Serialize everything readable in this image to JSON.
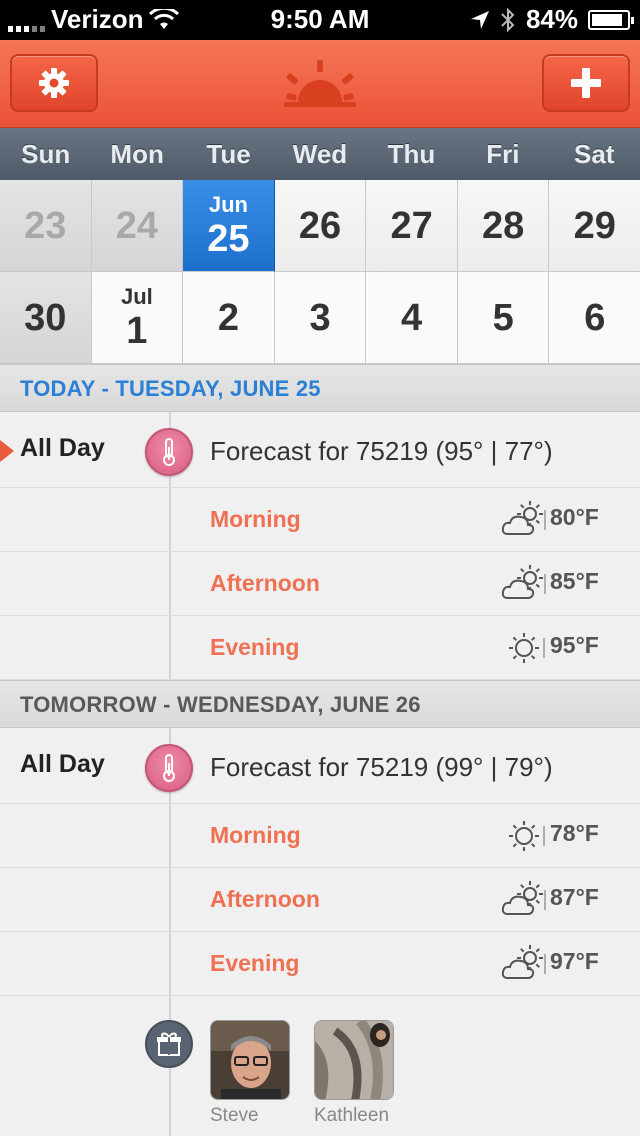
{
  "status": {
    "carrier": "Verizon",
    "time": "9:50 AM",
    "battery": "84%"
  },
  "weekdays": [
    "Sun",
    "Mon",
    "Tue",
    "Wed",
    "Thu",
    "Fri",
    "Sat"
  ],
  "calendar": {
    "row1": [
      {
        "day": "23",
        "month": "",
        "state": "past"
      },
      {
        "day": "24",
        "month": "",
        "state": "past"
      },
      {
        "day": "25",
        "month": "Jun",
        "state": "today"
      },
      {
        "day": "26",
        "month": "",
        "state": "normal"
      },
      {
        "day": "27",
        "month": "",
        "state": "normal"
      },
      {
        "day": "28",
        "month": "",
        "state": "normal"
      },
      {
        "day": "29",
        "month": "",
        "state": "normal"
      }
    ],
    "row2": [
      {
        "day": "30",
        "month": "",
        "state": "pastdark"
      },
      {
        "day": "1",
        "month": "Jul",
        "state": "white"
      },
      {
        "day": "2",
        "month": "",
        "state": "white"
      },
      {
        "day": "3",
        "month": "",
        "state": "white"
      },
      {
        "day": "4",
        "month": "",
        "state": "white"
      },
      {
        "day": "5",
        "month": "",
        "state": "white"
      },
      {
        "day": "6",
        "month": "",
        "state": "white"
      }
    ]
  },
  "today": {
    "header": "TODAY - TUESDAY, JUNE 25",
    "allday_label": "All Day",
    "forecast": "Forecast for 75219 (95° | 77°)",
    "periods": [
      {
        "name": "Morning",
        "icon": "partly-cloudy-icon",
        "temp": "80°F"
      },
      {
        "name": "Afternoon",
        "icon": "partly-cloudy-icon",
        "temp": "85°F"
      },
      {
        "name": "Evening",
        "icon": "sunny-icon",
        "temp": "95°F"
      }
    ]
  },
  "tomorrow": {
    "header": "TOMORROW - WEDNESDAY, JUNE 26",
    "allday_label": "All Day",
    "forecast": "Forecast for 75219 (99° | 79°)",
    "periods": [
      {
        "name": "Morning",
        "icon": "sunny-icon",
        "temp": "78°F"
      },
      {
        "name": "Afternoon",
        "icon": "partly-cloudy-icon",
        "temp": "87°F"
      },
      {
        "name": "Evening",
        "icon": "partly-cloudy-icon",
        "temp": "97°F"
      }
    ]
  },
  "birthdays": [
    {
      "name": "Steve"
    },
    {
      "name": "Kathleen"
    }
  ],
  "colors": {
    "accent": "#ec5338",
    "today_blue": "#1c6fcc",
    "period": "#ef7052"
  }
}
